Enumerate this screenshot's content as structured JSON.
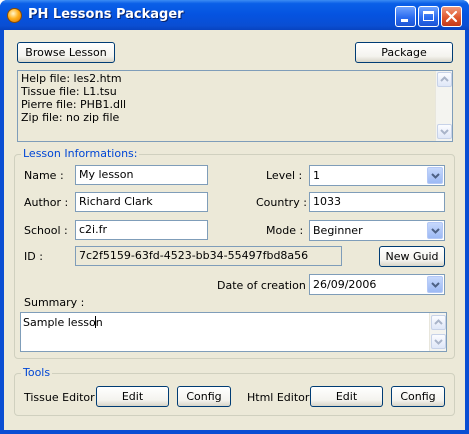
{
  "window": {
    "title": "PH Lessons Packager"
  },
  "toolbar": {
    "browse_label": "Browse Lesson",
    "package_label": "Package"
  },
  "info": {
    "lines": [
      "Help file: les2.htm",
      "Tissue file: L1.tsu",
      "Pierre file: PHB1.dll",
      "Zip file: no zip file"
    ]
  },
  "lesson": {
    "group_title": "Lesson Informations:",
    "name_label": "Name :",
    "name_value": "My lesson",
    "author_label": "Author :",
    "author_value": "Richard Clark",
    "school_label": "School :",
    "school_value": "c2i.fr",
    "id_label": "ID :",
    "id_value": "7c2f5159-63fd-4523-bb34-55497fbd8a56",
    "level_label": "Level :",
    "level_value": "1",
    "country_label": "Country :",
    "country_value": "1033",
    "mode_label": "Mode :",
    "mode_value": "Beginner",
    "new_guid_label": "New Guid",
    "date_label": "Date of creation :",
    "date_value": "26/09/2006",
    "summary_label": "Summary :",
    "summary_value": "Sample lesson"
  },
  "tools": {
    "group_title": "Tools",
    "tissue_label": "Tissue Editor",
    "html_label": "Html Editor",
    "edit_label": "Edit",
    "config_label": "Config"
  },
  "colors": {
    "titlebar": "#0a4ed3",
    "group_title": "#0046d5",
    "client_bg": "#ece9d8"
  },
  "icons": {
    "app": "orange-globe-icon",
    "minimize": "minimize-icon",
    "maximize": "maximize-icon",
    "close": "close-icon"
  }
}
